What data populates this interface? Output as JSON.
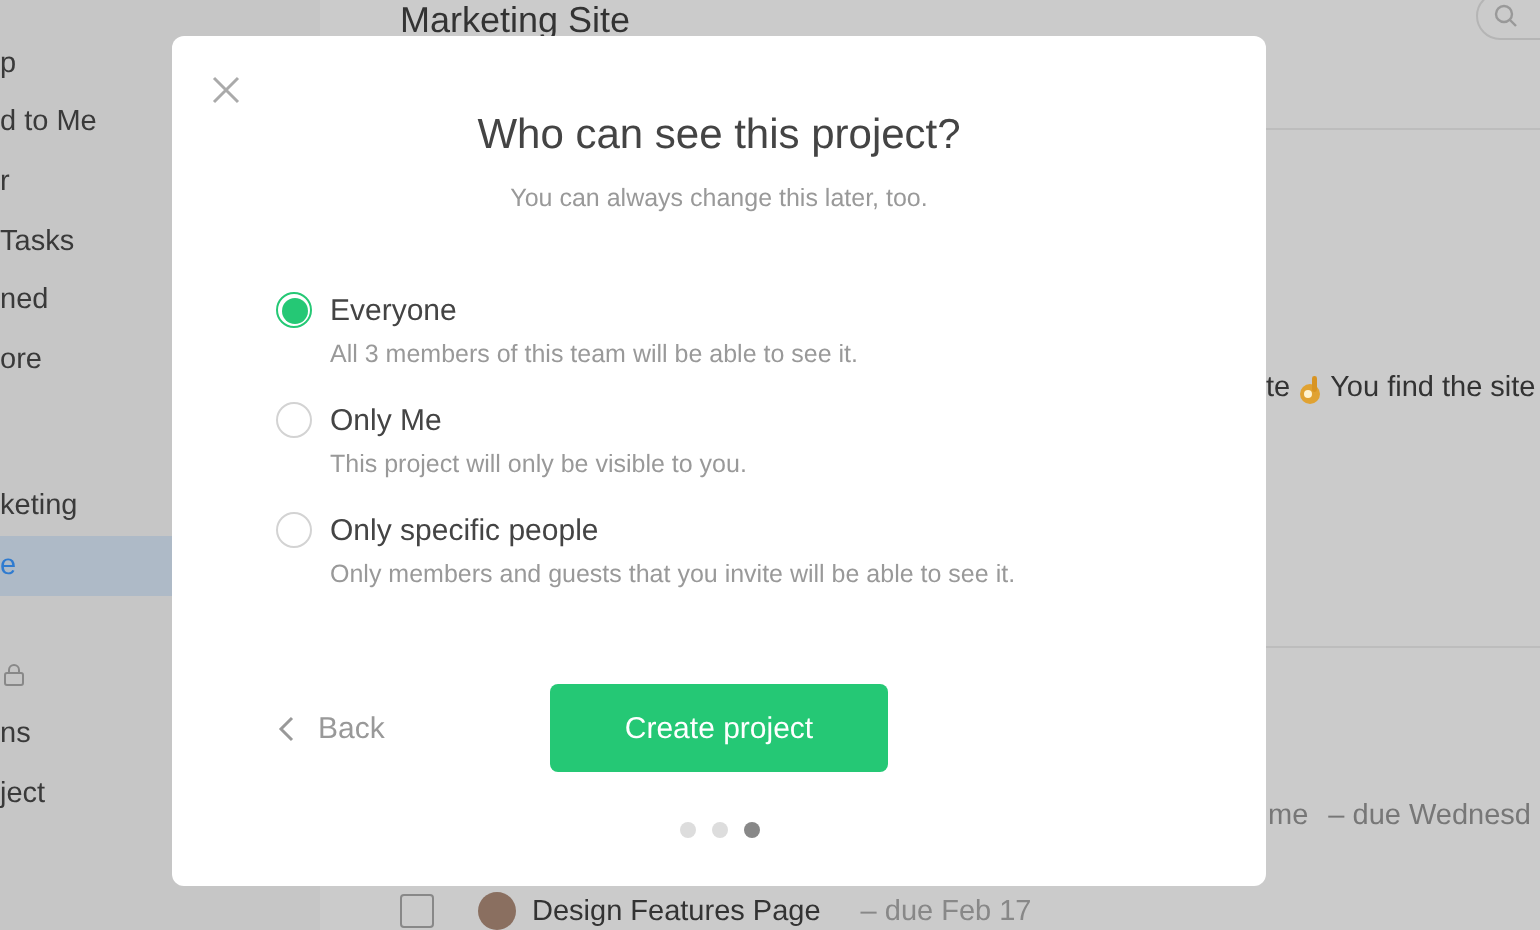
{
  "sidebar": {
    "groups": [
      {
        "items": [
          {
            "kind": "label",
            "label": "p",
            "selected": false
          },
          {
            "kind": "label",
            "label": "d to Me",
            "selected": false
          },
          {
            "kind": "label",
            "label": "r",
            "selected": false
          },
          {
            "kind": "label",
            "label": "Tasks",
            "selected": false
          },
          {
            "kind": "label",
            "label": "ned",
            "selected": false
          },
          {
            "kind": "label",
            "label": "ore",
            "selected": false
          }
        ]
      },
      {
        "items": [
          {
            "kind": "label",
            "label": "keting",
            "selected": false
          },
          {
            "kind": "label",
            "label": "e",
            "selected": true
          }
        ]
      },
      {
        "items": [
          {
            "kind": "lock",
            "selected": false
          },
          {
            "kind": "label",
            "label": "ns",
            "selected": false
          },
          {
            "kind": "label",
            "label": "ject",
            "selected": false
          }
        ]
      }
    ]
  },
  "main": {
    "title": "Marketing Site",
    "comment": {
      "before": "te",
      "after": "You find the site"
    },
    "task_line": {
      "name": "me",
      "due": "– due Wednesd"
    },
    "task_row": {
      "checked": false,
      "name": "Design Features Page",
      "due": "– due Feb 17"
    }
  },
  "dialog": {
    "title": "Who can see this project?",
    "subtitle": "You can always change this later, too.",
    "options": [
      {
        "label": "Everyone",
        "description": "All 3 members of this team will be able to see it.",
        "selected": true
      },
      {
        "label": "Only Me",
        "description": "This project will only be visible to you.",
        "selected": false
      },
      {
        "label": "Only specific people",
        "description": "Only members and guests that you invite will be able to see it.",
        "selected": false
      }
    ],
    "back": "Back",
    "primary": "Create project",
    "steps": [
      {
        "selected": false
      },
      {
        "selected": false
      },
      {
        "selected": true
      }
    ]
  }
}
